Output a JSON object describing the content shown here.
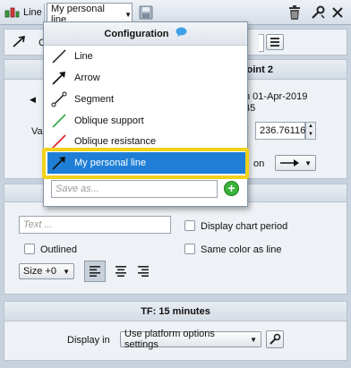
{
  "toolbar": {
    "tool_label": "Line",
    "preset_label": "My personal line",
    "icons": [
      "line-tool-icon",
      "save-icon",
      "trash-icon",
      "settings-icon",
      "close-icon"
    ]
  },
  "row1": {
    "label_fragment": "Co"
  },
  "points": {
    "header_fragment": "oint 2",
    "date_fragment": "n 01-Apr-2019",
    "time_fragment": "45",
    "value_label_fragment": "Val",
    "value": "236.76116",
    "style_fragment": "on"
  },
  "text_section": {
    "text_placeholder": "Text ...",
    "display_chart_period": "Display chart period",
    "outlined": "Outlined",
    "same_color_as_line": "Same color as line",
    "size_value": "Size +0"
  },
  "tf_section": {
    "title": "TF: 15 minutes",
    "display_in_label": "Display in",
    "display_in_value": "Use platform options settings"
  },
  "popup": {
    "title": "Configuration",
    "items": [
      {
        "label": "Line",
        "icon": "line-icon"
      },
      {
        "label": "Arrow",
        "icon": "arrow-icon"
      },
      {
        "label": "Segment",
        "icon": "segment-icon"
      },
      {
        "label": "Oblique support",
        "icon": "green-line-icon"
      },
      {
        "label": "Oblique resistance",
        "icon": "red-line-icon"
      },
      {
        "label": "My personal line",
        "icon": "arrow-icon"
      }
    ],
    "selected_index": 5,
    "save_placeholder": "Save as...",
    "colors": {
      "selected": "#1f7fd6",
      "highlight": "#f2d21a",
      "support": "#2fa84a",
      "resistance": "#e02020"
    }
  }
}
